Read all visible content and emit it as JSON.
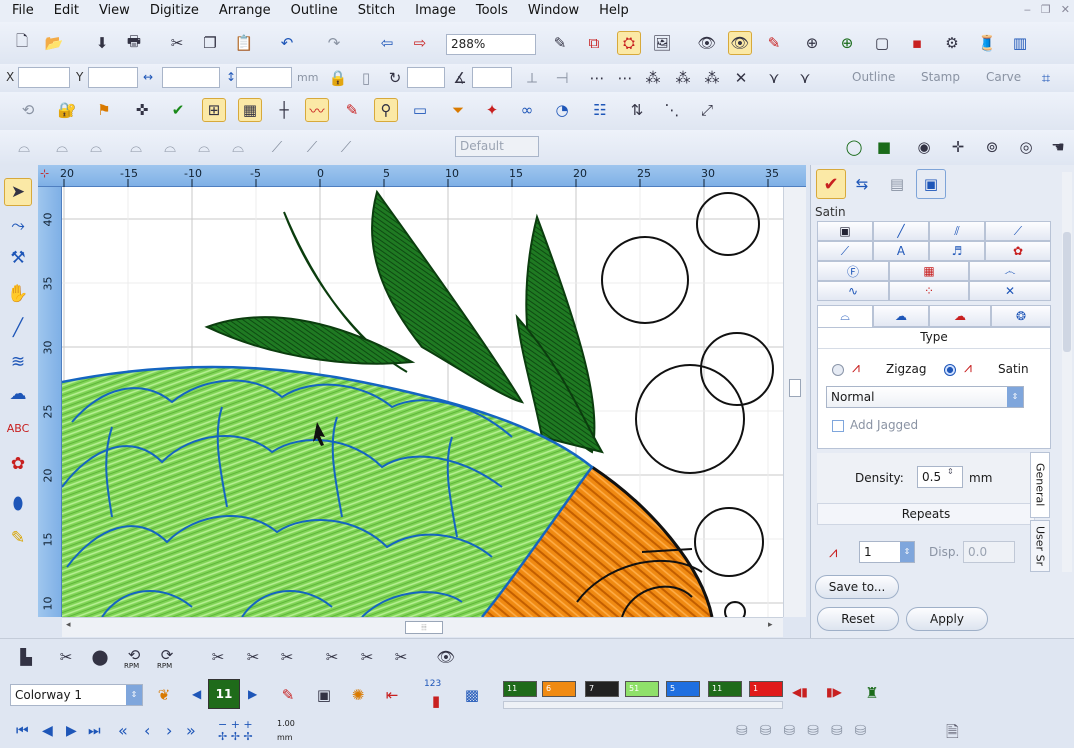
{
  "menu": [
    "File",
    "Edit",
    "View",
    "Digitize",
    "Arrange",
    "Outline",
    "Stitch",
    "Image",
    "Tools",
    "Window",
    "Help"
  ],
  "toolbar": {
    "zoom": "288%",
    "coord_x_label": "X",
    "coord_y_label": "Y",
    "unit": "mm",
    "outline_label": "Outline",
    "stamp_label": "Stamp",
    "carve_label": "Carve",
    "style_placeholder": "Default"
  },
  "ruler": {
    "top_ticks": [
      "20",
      "-15",
      "-10",
      "-5",
      "0",
      "5",
      "10",
      "15",
      "20",
      "25",
      "30",
      "35"
    ],
    "left_ticks": [
      "40",
      "35",
      "30",
      "25",
      "20",
      "15",
      "10"
    ]
  },
  "props": {
    "title": "Satin",
    "type_header": "Type",
    "zigzag_label": "Zigzag",
    "satin_label": "Satin",
    "fill_select": "Normal",
    "add_jagged_label": "Add Jagged",
    "density_label": "Density:",
    "density_value": "0.5",
    "density_unit": "mm",
    "repeats_header": "Repeats",
    "repeats_value": "1",
    "disp_label": "Disp.",
    "disp_value": "0.0",
    "save_to": "Save to...",
    "reset": "Reset",
    "apply": "Apply",
    "tab_general": "General",
    "tab_user": "User Sr"
  },
  "bottom": {
    "colorway": "Colorway 1",
    "color_count": "11",
    "speed_value": "1.00",
    "speed_unit": "mm",
    "counter": "123",
    "swatches": [
      {
        "label": "11",
        "color": "#1f6b1a"
      },
      {
        "label": "6",
        "color": "#f08a12"
      },
      {
        "label": "7",
        "color": "#222222"
      },
      {
        "label": "51",
        "color": "#8fe06a"
      },
      {
        "label": "5",
        "color": "#1f6fe0"
      },
      {
        "label": "11",
        "color": "#1f6b1a"
      },
      {
        "label": "1",
        "color": "#e01a1a"
      }
    ],
    "rpm_label": "RPM"
  },
  "colors": {
    "accent": "#4f7fc0",
    "ruler": "#8dbbea",
    "selected": "#fbe9a6"
  }
}
